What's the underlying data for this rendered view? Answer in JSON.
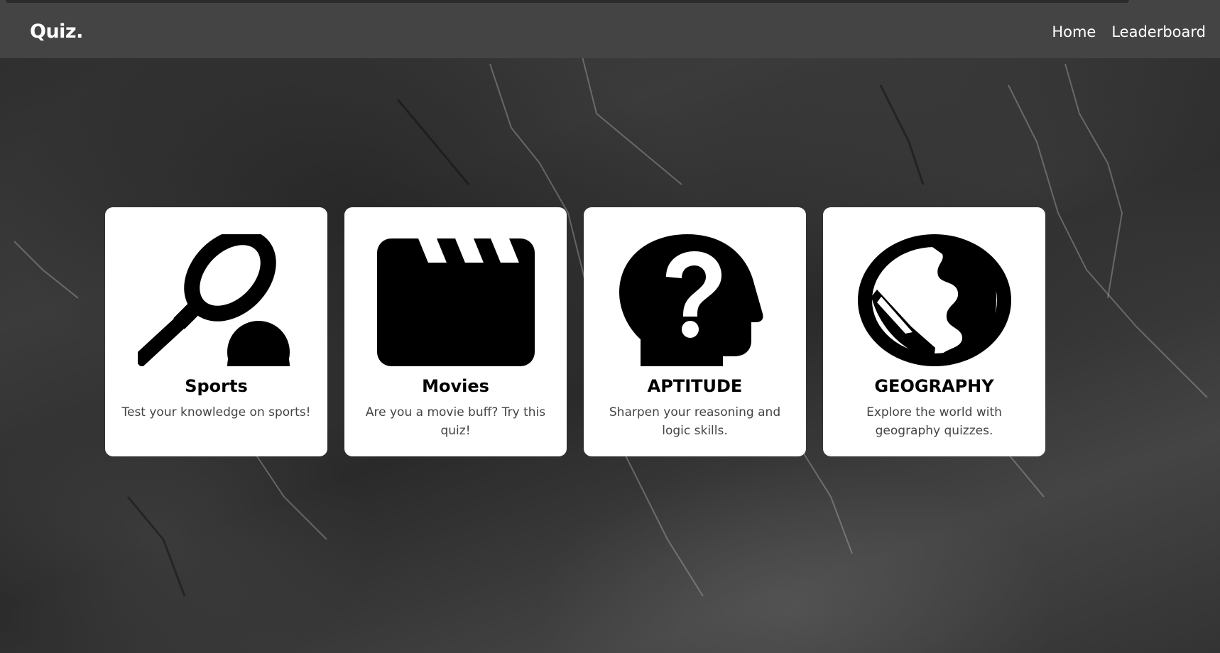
{
  "header": {
    "brand": "Quiz.",
    "nav": {
      "home": "Home",
      "leaderboard": "Leaderboard"
    }
  },
  "categories": [
    {
      "icon": "tennis-icon",
      "title": "Sports",
      "description": "Test your knowledge on sports!"
    },
    {
      "icon": "clapperboard-icon",
      "title": "Movies",
      "description": "Are you a movie buff? Try this quiz!"
    },
    {
      "icon": "head-question-icon",
      "title": "APTITUDE",
      "description": "Sharpen your reasoning and logic skills."
    },
    {
      "icon": "globe-icon",
      "title": "GEOGRAPHY",
      "description": "Explore the world with geography quizzes."
    }
  ],
  "colors": {
    "navbar": "#444444",
    "card": "#ffffff",
    "title": "#000000",
    "description": "#444444"
  }
}
